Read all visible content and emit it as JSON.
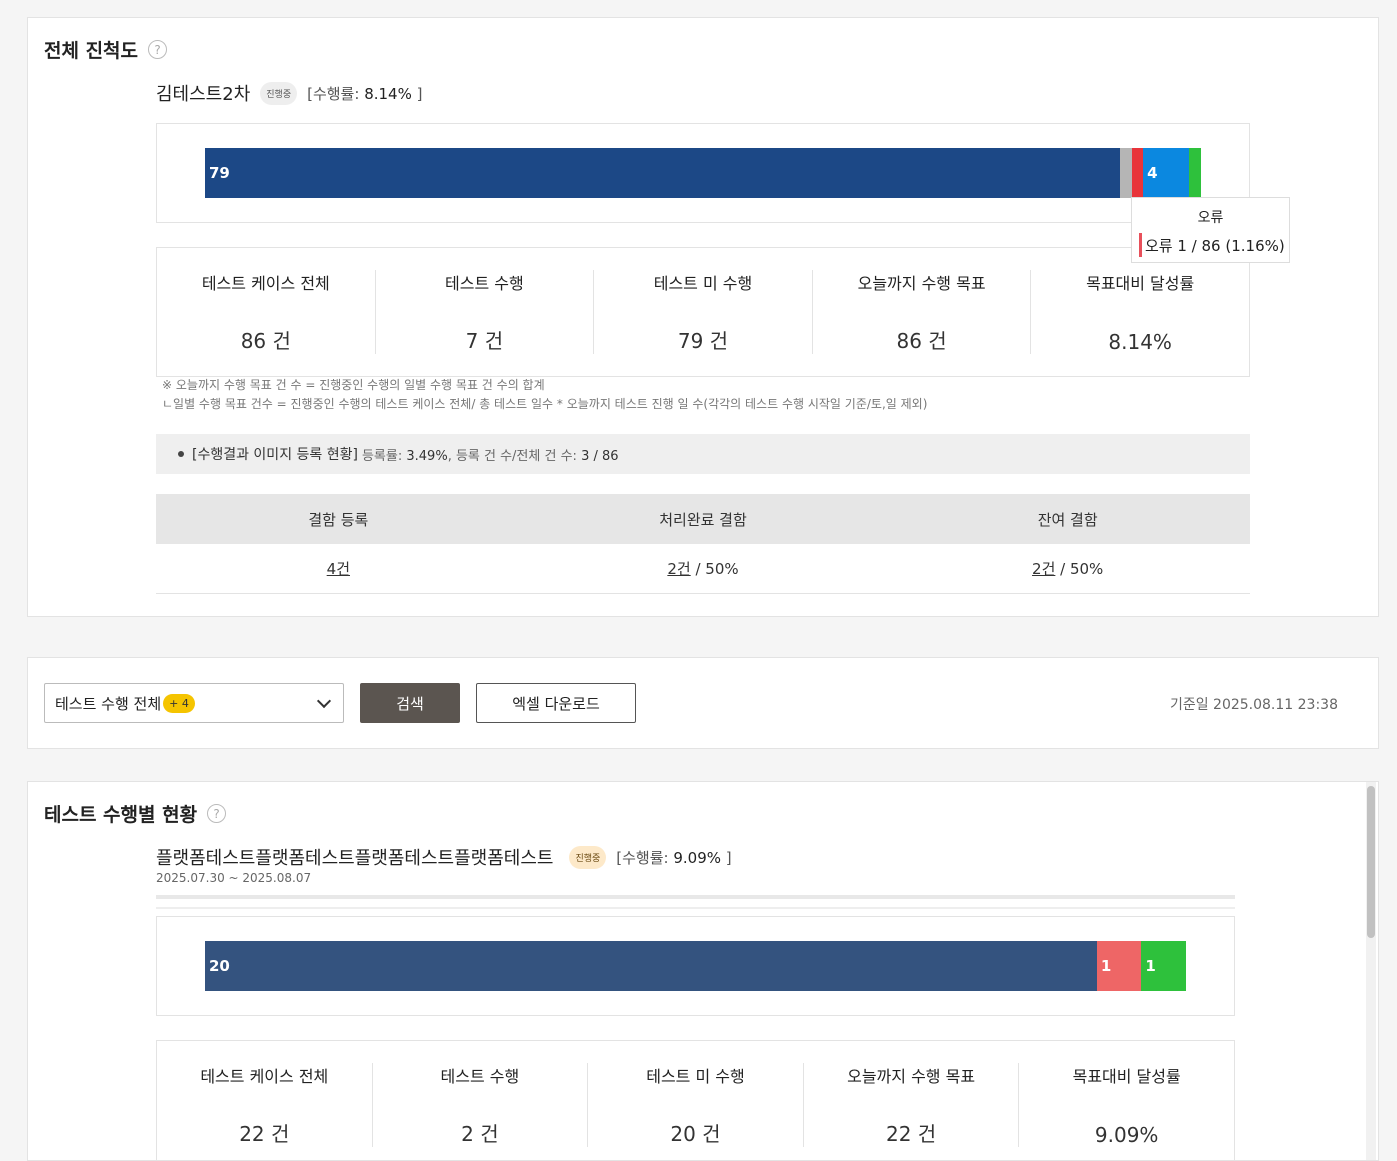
{
  "overall": {
    "title": "전체 진척도",
    "help": "?",
    "project_name": "김테스트2차",
    "status_badge": "진행중",
    "rate_prefix": "[수행률: ",
    "rate_value": "8.14%",
    "rate_suffix": " ]",
    "bar_segments": [
      {
        "label": "79",
        "value": 79,
        "color": "#1c4886"
      },
      {
        "label": "",
        "value": 1,
        "color": "#b5b5b5"
      },
      {
        "label": "",
        "value": 1,
        "color": "#e8343a"
      },
      {
        "label": "4",
        "value": 4,
        "color": "#0b88e0"
      },
      {
        "label": "",
        "value": 1,
        "color": "#2ec13c"
      }
    ],
    "tooltip": {
      "title": "오류",
      "text": "오류 1 / 86 (1.16%)",
      "color": "#e8505b"
    },
    "stats": [
      {
        "label": "테스트 케이스 전체",
        "value": "86 건"
      },
      {
        "label": "테스트 수행",
        "value": "7 건"
      },
      {
        "label": "테스트 미 수행",
        "value": "79 건"
      },
      {
        "label": "오늘까지 수행 목표",
        "value": "86 건"
      },
      {
        "label": "목표대비 달성률",
        "value": "8.14%"
      }
    ],
    "note1": "※ 오늘까지 수행 목표 건 수 = 진행중인 수행의 일별 수행 목표 건 수의 합계",
    "note2": "ㄴ일별 수행 목표 건수 = 진행중인 수행의 테스트 케이스 전체/ 총 테스트 일수 * 오늘까지 테스트 진행 일 수(각각의 테스트 수행 시작일 기준/토,일 제외)",
    "image_status": {
      "label": "[수행결과 이미지 등록 현황]",
      "rate_prefix": "등록률: ",
      "rate": "3.49%",
      "count_prefix": ", 등록 건 수/전체 건 수: ",
      "count": "3 / 86"
    },
    "defects": {
      "headers": [
        "결함 등록",
        "처리완료 결함",
        "잔여 결함"
      ],
      "registered": "4건",
      "resolved_count": "2건",
      "resolved_pct": " / 50%",
      "remaining_count": "2건",
      "remaining_pct": " / 50%"
    }
  },
  "filter": {
    "select_value": "테스트 수행 전체",
    "select_badge": "+ 4",
    "search_label": "검색",
    "excel_label": "엑셀 다운로드",
    "basis_date": "기준일 2025.08.11 23:38"
  },
  "per_run": {
    "title": "테스트 수행별 현황",
    "help": "?",
    "project_name": "플랫폼테스트플랫폼테스트플랫폼테스트플랫폼테스트",
    "status_badge": "진행중",
    "rate_prefix": "[수행률: ",
    "rate_value": "9.09%",
    "rate_suffix": " ]",
    "period": "2025.07.30 ~ 2025.08.07",
    "bar_segments": [
      {
        "label": "20",
        "value": 20,
        "color": "#34537f"
      },
      {
        "label": "1",
        "value": 1,
        "color": "#ee6666"
      },
      {
        "label": "1",
        "value": 1,
        "color": "#2ec13c"
      }
    ],
    "stats": [
      {
        "label": "테스트 케이스 전체",
        "value": "22 건"
      },
      {
        "label": "테스트 수행",
        "value": "2 건"
      },
      {
        "label": "테스트 미 수행",
        "value": "20 건"
      },
      {
        "label": "오늘까지 수행 목표",
        "value": "22 건"
      },
      {
        "label": "목표대비 달성률",
        "value": "9.09%"
      }
    ]
  }
}
